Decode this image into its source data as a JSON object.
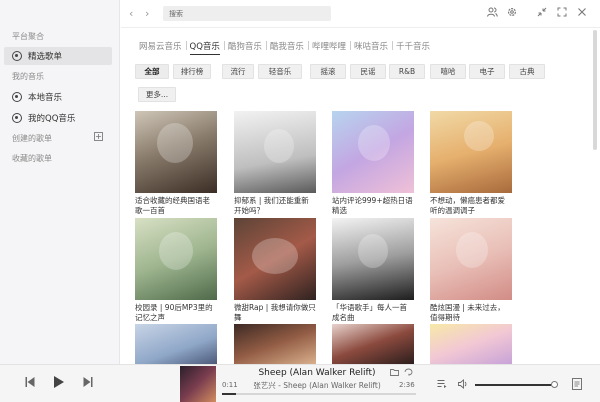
{
  "sidebar": {
    "section_platform": "平台聚合",
    "featured": "精选歌单",
    "section_my_music": "我的音乐",
    "local_music": "本地音乐",
    "my_qq_music": "我的QQ音乐",
    "created_playlists": "创建的歌单",
    "add_symbol": "+",
    "collected_playlists": "收藏的歌单"
  },
  "topbar": {
    "back": "‹",
    "forward": "›",
    "search_placeholder": "搜索",
    "icons": [
      "user-icon",
      "gear-icon",
      "minimize-icon",
      "maximize-icon",
      "close-icon"
    ]
  },
  "tabs": [
    "网易云音乐",
    "QQ音乐",
    "酷狗音乐",
    "酷我音乐",
    "哔哩哔哩",
    "咪咕音乐",
    "千千音乐"
  ],
  "active_tab": "QQ音乐",
  "genres": [
    "全部",
    "排行榜",
    "流行",
    "轻音乐",
    "摇滚",
    "民谣",
    "R&B",
    "嘻哈",
    "电子",
    "古典",
    "更多..."
  ],
  "active_genre": "全部",
  "playlists": [
    {
      "title": "适合收藏的经典国语老歌一百首"
    },
    {
      "title": "抑郁系 | 我们还能重新开始吗？"
    },
    {
      "title": "站内评论999+超热日语精选"
    },
    {
      "title": "不想动，懒癌患者都爱听的温调调子"
    },
    {
      "title": "校园录 | 90后MP3里的记忆之声"
    },
    {
      "title": "微甜Rap | 我想请你做只舞"
    },
    {
      "title": "「华语歌手」每人一首成名曲"
    },
    {
      "title": "酷炫国漫 | 未来过去，值得期待"
    },
    {
      "title": ""
    },
    {
      "title": ""
    },
    {
      "title": ""
    },
    {
      "title": ""
    }
  ],
  "player": {
    "song_title": "Sheep (Alan Walker Relift)",
    "song_sub": "张艺兴 - Sheep (Alan Walker Relift)",
    "elapsed": "0:11",
    "duration": "2:36",
    "progress_fraction": 0.07,
    "volume_fraction": 0.95
  },
  "colors": {
    "sidebar_bg": "#f5f5f7",
    "accent": "#333333",
    "chip_bg": "#f0f0f0"
  }
}
